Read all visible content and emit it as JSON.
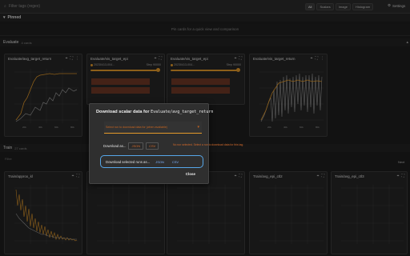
{
  "topbar": {
    "filter_placeholder": "Filter tags (regex)",
    "toggles": [
      "All",
      "Scalars",
      "Image",
      "Histogram"
    ],
    "settings_label": "Settings"
  },
  "pinned": {
    "title": "Pinned",
    "empty_text": "Pin cards for a quick view and comparison"
  },
  "evaluate": {
    "name": "Evaluate",
    "count": "4 cards",
    "cards": [
      {
        "title": "Evaluate/avg_target_return"
      },
      {
        "title": "Evaluate/vis_target_epi",
        "run": "20230413-004...",
        "step": "Step 90000"
      },
      {
        "title": "Evaluate/vis_target_epi",
        "run": "20230413-004...",
        "step": "Step 90000"
      },
      {
        "title": "Evaluate/vis_target_return"
      }
    ]
  },
  "train": {
    "name": "Train",
    "count": "27 cards",
    "filter_hint": "Filter",
    "next_label": "Next",
    "cards": [
      {
        "title": "Train/approx_kl"
      },
      {
        "title": "Train/avg..."
      },
      {
        "title": "Train/avg..."
      },
      {
        "title": "Train/avg_epi_ctl2"
      },
      {
        "title": "Train/avg_epi_ctl3"
      }
    ]
  },
  "dialog": {
    "title": "Download scalar data for ",
    "tag": "Evaluate/avg_target_return",
    "select_placeholder": "Select run to download data for (when available)",
    "download_as_label": "Download as...",
    "json_label": "JSON",
    "csv_label": "CSV",
    "error_text": "No run selected. Select a run to download data for this tag.",
    "selected_runs_label": "Download selected runs as...",
    "close_label": "Close"
  },
  "colors": {
    "accent": "#e49a2a",
    "series_gray": "#9a9a9a",
    "focus_blue": "#57a7e8"
  }
}
